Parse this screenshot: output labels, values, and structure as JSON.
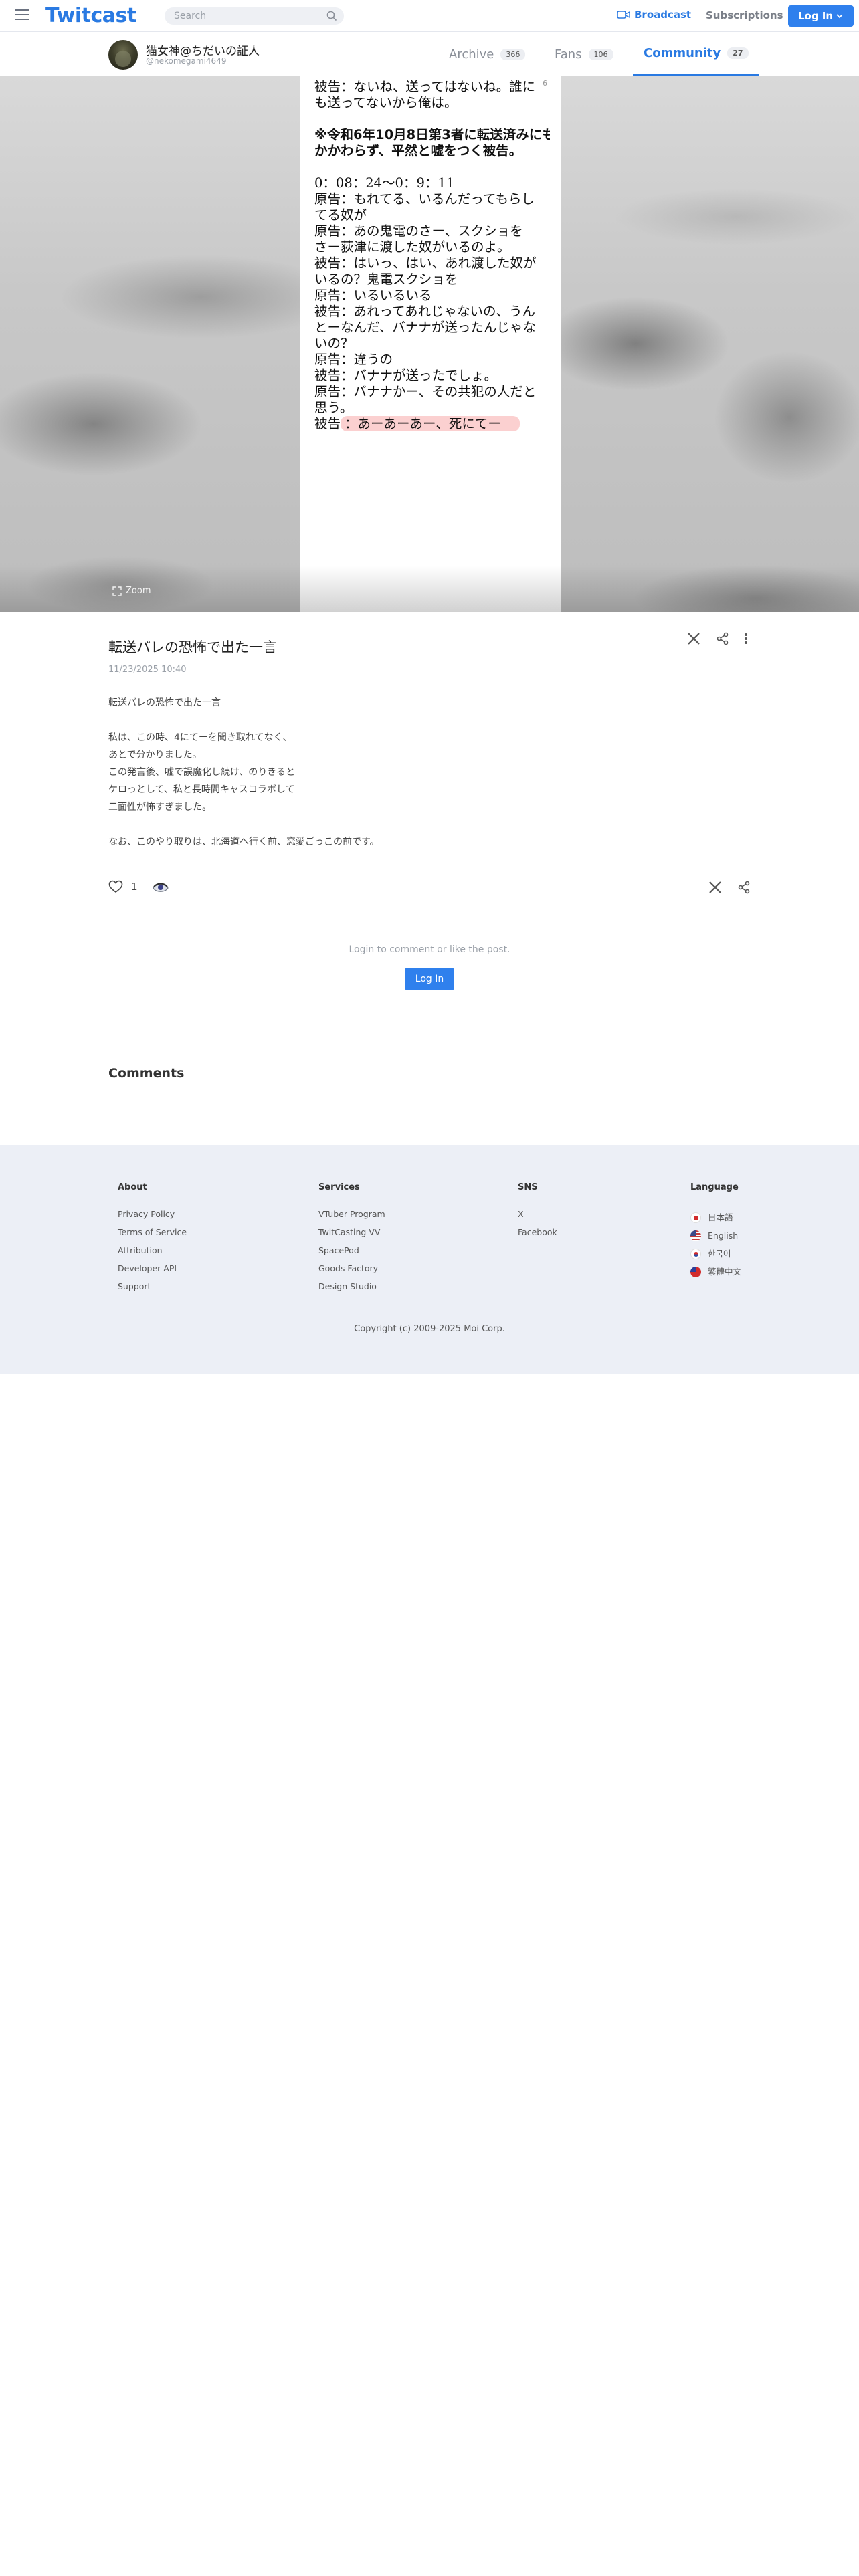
{
  "header": {
    "logo": "Twitcast",
    "search_placeholder": "Search",
    "broadcast_label": "Broadcast",
    "subscriptions_label": "Subscriptions",
    "login_label": "Log In"
  },
  "profile": {
    "name": "猫女神@ちだいの証人",
    "handle": "@nekomegami4649",
    "tabs": [
      {
        "label": "Archive",
        "count": "366"
      },
      {
        "label": "Fans",
        "count": "106"
      },
      {
        "label": "Community",
        "count": "27"
      }
    ]
  },
  "viewer": {
    "page_number": "6",
    "lines": [
      "被告：ないね、送ってはないね。誰に",
      "も送ってないから俺は。",
      "",
      "※令和6年10月8日第3者に転送済みにも",
      "かかわらず、平然と嘘をつく被告。",
      "",
      "0：08：24〜0：9：11",
      "原告：もれてる、いるんだってもらし",
      "てる奴が",
      "原告：あの鬼電のさー、スクショを",
      "さー荻津に渡した奴がいるのよ。",
      "被告：はいっ、はい、あれ渡した奴が",
      "いるの？鬼電スクショを",
      "原告：いるいるいる",
      "被告：あれってあれじゃないの、うん",
      "とーなんだ、バナナが送ったんじゃな",
      "いの？",
      "原告：違うの",
      "被告：バナナが送ったでしょ。",
      "原告：バナナかー、その共犯の人だと",
      "思う。"
    ],
    "highlight_speaker": "被告",
    "highlight_text": "：あーあーあー、死にてー",
    "zoom_label": "Zoom"
  },
  "post": {
    "title": "転送バレの恐怖で出た一言",
    "date": "11/23/2025 10:40",
    "body": [
      "転送バレの恐怖で出た一言",
      "",
      "私は、この時、4にてーを聞き取れてなく、",
      "あとで分かりました。",
      "この発言後、嘘で誤魔化し続け、のりきると",
      "ケロっとして、私と長時間キャスコラボして",
      "二面性が怖すぎました。",
      "",
      "なお、このやり取りは、北海道へ行く前、恋愛ごっこの前です。"
    ],
    "like_count": "1",
    "login_note": "Login to comment or like the post.",
    "login_button": "Log In",
    "comments_heading": "Comments"
  },
  "footer": {
    "about": {
      "heading": "About",
      "links": [
        "Privacy Policy",
        "Terms of Service",
        "Attribution",
        "Developer API",
        "Support"
      ]
    },
    "services": {
      "heading": "Services",
      "links": [
        "VTuber Program",
        "TwitCasting VV",
        "SpacePod",
        "Goods Factory",
        "Design Studio"
      ]
    },
    "sns": {
      "heading": "SNS",
      "links": [
        "X",
        "Facebook"
      ]
    },
    "language": {
      "heading": "Language",
      "links": [
        "日本語",
        "English",
        "한국어",
        "繁體中文"
      ]
    },
    "copyright": "Copyright (c) 2009-2025 Moi Corp."
  },
  "colors": {
    "accent": "#2a7ae2",
    "button": "#2f80ed",
    "footer_bg": "#eceff6",
    "highlight": "#fbd0d0"
  }
}
